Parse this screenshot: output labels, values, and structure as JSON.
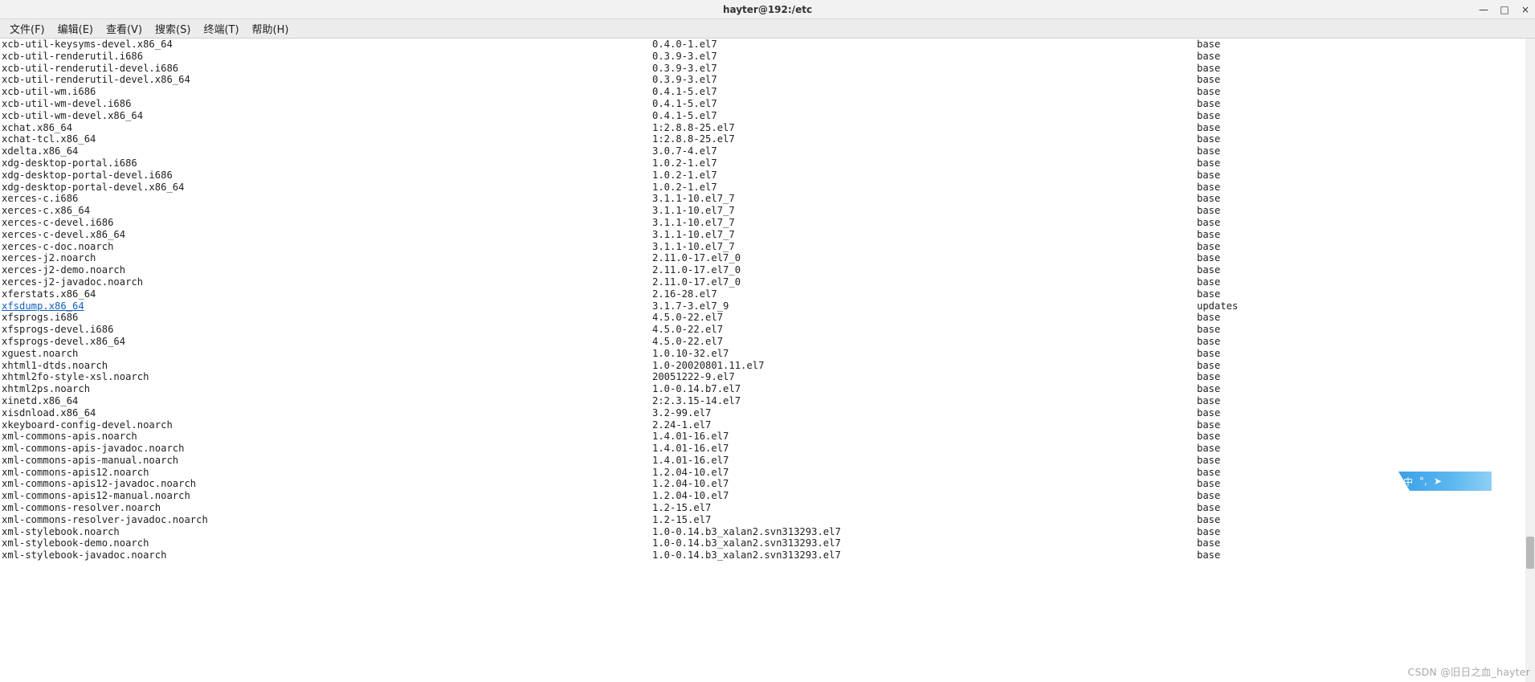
{
  "window": {
    "title": "hayter@192:/etc",
    "controls": {
      "min": "—",
      "max": "□",
      "close": "×"
    }
  },
  "menu": {
    "items": [
      "文件(F)",
      "编辑(E)",
      "查看(V)",
      "搜索(S)",
      "终端(T)",
      "帮助(H)"
    ]
  },
  "ime": {
    "label": "中",
    "punct": "°,",
    "send": "➤"
  },
  "watermark": "CSDN @旧日之血_hayter",
  "packages": [
    {
      "name": "xcb-util-keysyms-devel.x86_64",
      "version": "0.4.0-1.el7",
      "repo": "base"
    },
    {
      "name": "xcb-util-renderutil.i686",
      "version": "0.3.9-3.el7",
      "repo": "base"
    },
    {
      "name": "xcb-util-renderutil-devel.i686",
      "version": "0.3.9-3.el7",
      "repo": "base"
    },
    {
      "name": "xcb-util-renderutil-devel.x86_64",
      "version": "0.3.9-3.el7",
      "repo": "base"
    },
    {
      "name": "xcb-util-wm.i686",
      "version": "0.4.1-5.el7",
      "repo": "base"
    },
    {
      "name": "xcb-util-wm-devel.i686",
      "version": "0.4.1-5.el7",
      "repo": "base"
    },
    {
      "name": "xcb-util-wm-devel.x86_64",
      "version": "0.4.1-5.el7",
      "repo": "base"
    },
    {
      "name": "xchat.x86_64",
      "version": "1:2.8.8-25.el7",
      "repo": "base"
    },
    {
      "name": "xchat-tcl.x86_64",
      "version": "1:2.8.8-25.el7",
      "repo": "base"
    },
    {
      "name": "xdelta.x86_64",
      "version": "3.0.7-4.el7",
      "repo": "base"
    },
    {
      "name": "xdg-desktop-portal.i686",
      "version": "1.0.2-1.el7",
      "repo": "base"
    },
    {
      "name": "xdg-desktop-portal-devel.i686",
      "version": "1.0.2-1.el7",
      "repo": "base"
    },
    {
      "name": "xdg-desktop-portal-devel.x86_64",
      "version": "1.0.2-1.el7",
      "repo": "base"
    },
    {
      "name": "xerces-c.i686",
      "version": "3.1.1-10.el7_7",
      "repo": "base"
    },
    {
      "name": "xerces-c.x86_64",
      "version": "3.1.1-10.el7_7",
      "repo": "base"
    },
    {
      "name": "xerces-c-devel.i686",
      "version": "3.1.1-10.el7_7",
      "repo": "base"
    },
    {
      "name": "xerces-c-devel.x86_64",
      "version": "3.1.1-10.el7_7",
      "repo": "base"
    },
    {
      "name": "xerces-c-doc.noarch",
      "version": "3.1.1-10.el7_7",
      "repo": "base"
    },
    {
      "name": "xerces-j2.noarch",
      "version": "2.11.0-17.el7_0",
      "repo": "base"
    },
    {
      "name": "xerces-j2-demo.noarch",
      "version": "2.11.0-17.el7_0",
      "repo": "base"
    },
    {
      "name": "xerces-j2-javadoc.noarch",
      "version": "2.11.0-17.el7_0",
      "repo": "base"
    },
    {
      "name": "xferstats.x86_64",
      "version": "2.16-28.el7",
      "repo": "base"
    },
    {
      "name": "xfsdump.x86_64",
      "version": "3.1.7-3.el7_9",
      "repo": "updates",
      "highlight": true
    },
    {
      "name": "xfsprogs.i686",
      "version": "4.5.0-22.el7",
      "repo": "base"
    },
    {
      "name": "xfsprogs-devel.i686",
      "version": "4.5.0-22.el7",
      "repo": "base"
    },
    {
      "name": "xfsprogs-devel.x86_64",
      "version": "4.5.0-22.el7",
      "repo": "base"
    },
    {
      "name": "xguest.noarch",
      "version": "1.0.10-32.el7",
      "repo": "base"
    },
    {
      "name": "xhtml1-dtds.noarch",
      "version": "1.0-20020801.11.el7",
      "repo": "base"
    },
    {
      "name": "xhtml2fo-style-xsl.noarch",
      "version": "20051222-9.el7",
      "repo": "base"
    },
    {
      "name": "xhtml2ps.noarch",
      "version": "1.0-0.14.b7.el7",
      "repo": "base"
    },
    {
      "name": "xinetd.x86_64",
      "version": "2:2.3.15-14.el7",
      "repo": "base"
    },
    {
      "name": "xisdnload.x86_64",
      "version": "3.2-99.el7",
      "repo": "base"
    },
    {
      "name": "xkeyboard-config-devel.noarch",
      "version": "2.24-1.el7",
      "repo": "base"
    },
    {
      "name": "xml-commons-apis.noarch",
      "version": "1.4.01-16.el7",
      "repo": "base"
    },
    {
      "name": "xml-commons-apis-javadoc.noarch",
      "version": "1.4.01-16.el7",
      "repo": "base"
    },
    {
      "name": "xml-commons-apis-manual.noarch",
      "version": "1.4.01-16.el7",
      "repo": "base"
    },
    {
      "name": "xml-commons-apis12.noarch",
      "version": "1.2.04-10.el7",
      "repo": "base"
    },
    {
      "name": "xml-commons-apis12-javadoc.noarch",
      "version": "1.2.04-10.el7",
      "repo": "base"
    },
    {
      "name": "xml-commons-apis12-manual.noarch",
      "version": "1.2.04-10.el7",
      "repo": "base"
    },
    {
      "name": "xml-commons-resolver.noarch",
      "version": "1.2-15.el7",
      "repo": "base"
    },
    {
      "name": "xml-commons-resolver-javadoc.noarch",
      "version": "1.2-15.el7",
      "repo": "base"
    },
    {
      "name": "xml-stylebook.noarch",
      "version": "1.0-0.14.b3_xalan2.svn313293.el7",
      "repo": "base"
    },
    {
      "name": "xml-stylebook-demo.noarch",
      "version": "1.0-0.14.b3_xalan2.svn313293.el7",
      "repo": "base"
    },
    {
      "name": "xml-stylebook-javadoc.noarch",
      "version": "1.0-0.14.b3_xalan2.svn313293.el7",
      "repo": "base"
    }
  ]
}
